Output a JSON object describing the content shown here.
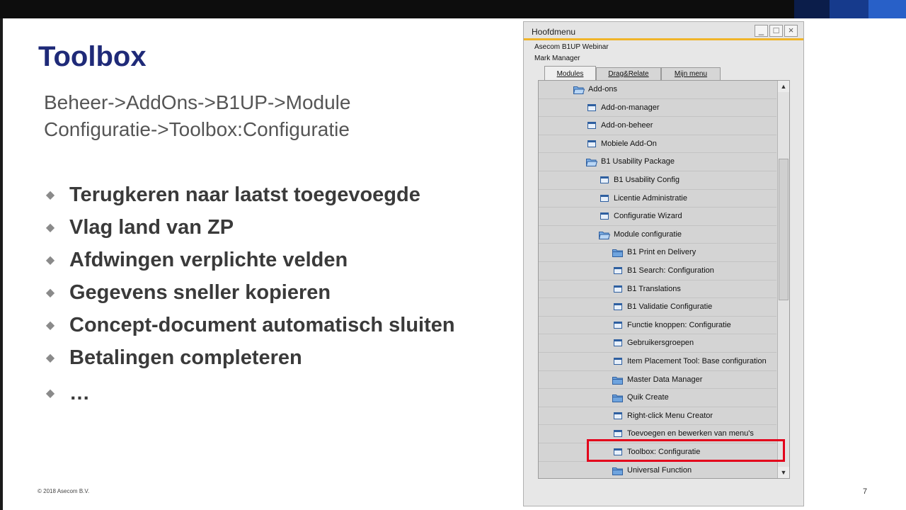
{
  "slide": {
    "title": "Toolbox",
    "path_line1": "Beheer->AddOns->B1UP->Module",
    "path_line2": "Configuratie->Toolbox:Configuratie",
    "bullets": [
      "Terugkeren naar laatst toegevoegde",
      "Vlag land van ZP",
      "Afdwingen verplichte velden",
      "Gegevens sneller kopieren",
      "Concept-document automatisch sluiten",
      "Betalingen completeren",
      "…"
    ],
    "bullet_glyph": "◆",
    "footer": "© 2018 Asecom B.V.",
    "page_number": "7"
  },
  "window": {
    "title": "Hoofdmenu",
    "company": "Asecom B1UP Webinar",
    "user": "Mark Manager",
    "controls": {
      "minimize": "_",
      "maximize": "□",
      "close": "×"
    },
    "tabs": [
      "Modules",
      "Drag&Relate",
      "Mijn menu"
    ],
    "active_tab": "Modules",
    "tree": [
      {
        "label": "Add-ons",
        "icon": "folder-open-icon",
        "level": 1
      },
      {
        "label": "Add-on-manager",
        "icon": "form-icon",
        "level": 2
      },
      {
        "label": "Add-on-beheer",
        "icon": "form-icon",
        "level": 2
      },
      {
        "label": "Mobiele Add-On",
        "icon": "form-icon",
        "level": 2
      },
      {
        "label": "B1 Usability Package",
        "icon": "folder-open-icon",
        "level": 2
      },
      {
        "label": "B1 Usability Config",
        "icon": "form-icon",
        "level": 3
      },
      {
        "label": "Licentie Administratie",
        "icon": "form-icon",
        "level": 3
      },
      {
        "label": "Configuratie Wizard",
        "icon": "form-icon",
        "level": 3
      },
      {
        "label": "Module configuratie",
        "icon": "folder-open-icon",
        "level": 3
      },
      {
        "label": "B1 Print en Delivery",
        "icon": "folder-icon",
        "level": 4
      },
      {
        "label": "B1 Search: Configuration",
        "icon": "form-icon",
        "level": 4
      },
      {
        "label": "B1 Translations",
        "icon": "form-icon",
        "level": 4
      },
      {
        "label": "B1 Validatie Configuratie",
        "icon": "form-icon",
        "level": 4
      },
      {
        "label": "Functie knoppen: Configuratie",
        "icon": "form-icon",
        "level": 4
      },
      {
        "label": "Gebruikersgroepen",
        "icon": "form-icon",
        "level": 4
      },
      {
        "label": "Item Placement Tool: Base configuration",
        "icon": "form-icon",
        "level": 4
      },
      {
        "label": "Master Data Manager",
        "icon": "folder-icon",
        "level": 4
      },
      {
        "label": "Quik Create",
        "icon": "folder-icon",
        "level": 4
      },
      {
        "label": "Right-click Menu Creator",
        "icon": "form-icon",
        "level": 4
      },
      {
        "label": "Toevoegen en bewerken van menu's",
        "icon": "form-icon",
        "level": 4
      },
      {
        "label": "Toolbox: Configuratie",
        "icon": "form-icon",
        "level": 4,
        "highlighted": true
      },
      {
        "label": "Universal Function",
        "icon": "folder-icon",
        "level": 4
      }
    ],
    "colors": {
      "highlight": "#e3001b",
      "title_accent": "#f0b429",
      "slide_title": "#1f2a78"
    }
  }
}
